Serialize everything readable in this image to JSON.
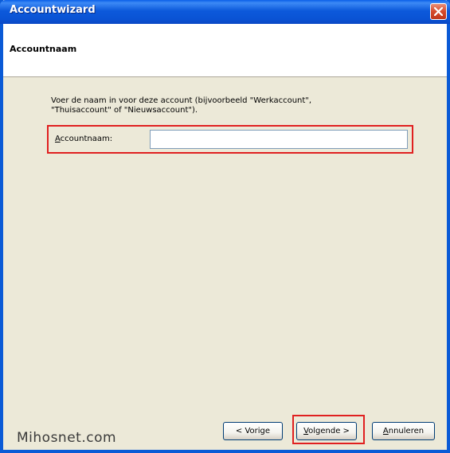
{
  "window": {
    "title": "Accountwizard",
    "close_icon": "close-icon"
  },
  "header": {
    "title": "Accountnaam"
  },
  "content": {
    "description_line1": "Voer de naam in voor deze account (bijvoorbeeld \"Werkaccount\",",
    "description_line2": "\"Thuisaccount\" of \"Nieuwsaccount\").",
    "field_label_accel": "A",
    "field_label_rest": "ccountnaam:",
    "field_value": ""
  },
  "buttons": {
    "prev_label": "< Vorige",
    "next_accel": "V",
    "next_rest": "olgende >",
    "cancel_accel": "A",
    "cancel_rest": "nnuleren"
  },
  "watermark": "Mihosnet.com",
  "colors": {
    "titlebar": "#0a53d4",
    "highlight": "#e02020",
    "dialog_bg": "#ece9d8"
  }
}
